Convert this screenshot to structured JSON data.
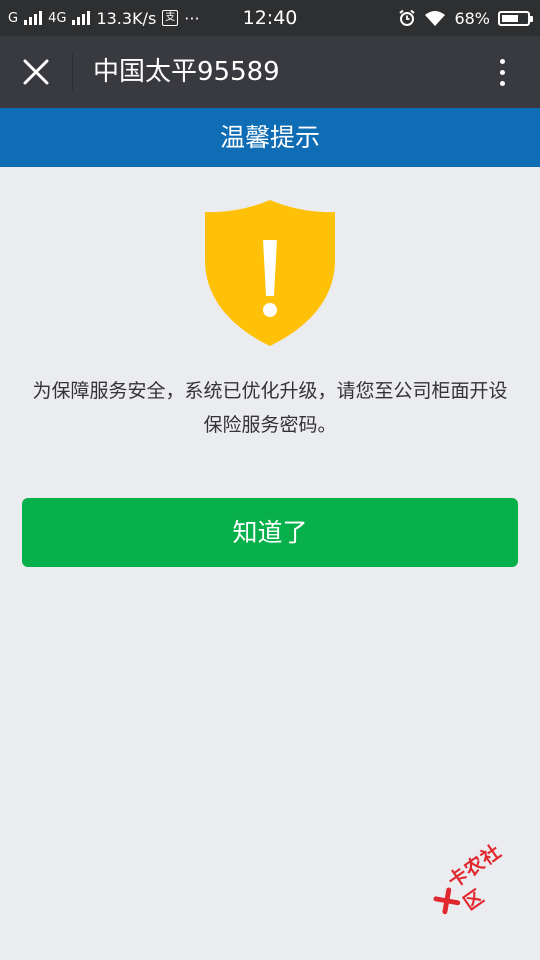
{
  "status_bar": {
    "carrier1": "G",
    "carrier2": "4G",
    "net_speed": "13.3K/s",
    "app_glyph": "支",
    "more_dots": "···",
    "time": "12:40",
    "battery_percent": "68%",
    "battery_level": 0.68
  },
  "title_bar": {
    "title": "中国太平95589"
  },
  "notice": {
    "header": "温馨提示",
    "message_line1": "为保障服务安全，系统已优化升级，请您至公司柜面开设",
    "message_line2": "保险服务密码。",
    "confirm_label": "知道了"
  },
  "watermark": {
    "text": "卡农社区"
  },
  "colors": {
    "status_bar_bg": "#2e2f31",
    "title_bar_bg": "#393a3f",
    "header_bg": "#0e6db5",
    "shield": "#ffc107",
    "button_bg": "#07b04a",
    "page_bg": "#ebecf0",
    "watermark": "#e0282e"
  },
  "icons": {
    "close": "close-icon",
    "more": "more-vertical-icon",
    "warning": "warning-shield-icon",
    "alarm": "alarm-icon",
    "wifi": "wifi-icon",
    "battery": "battery-icon"
  }
}
